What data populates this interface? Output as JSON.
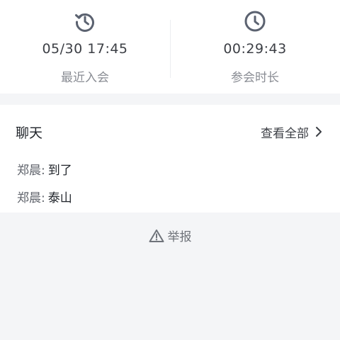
{
  "stats": {
    "last_join": {
      "value": "05/30 17:45",
      "label": "最近入会",
      "icon": "history-clock-icon"
    },
    "duration": {
      "value": "00:29:43",
      "label": "参会时长",
      "icon": "clock-icon"
    }
  },
  "chat": {
    "title": "聊天",
    "view_all": "查看全部",
    "messages": [
      {
        "sender": "郑晨:",
        "text": "到了"
      },
      {
        "sender": "郑晨:",
        "text": "泰山"
      }
    ]
  },
  "report": {
    "label": "举报",
    "icon": "warning-icon"
  },
  "colors": {
    "icon": "#5b6270",
    "background": "#f4f5f7",
    "card": "#ffffff"
  }
}
